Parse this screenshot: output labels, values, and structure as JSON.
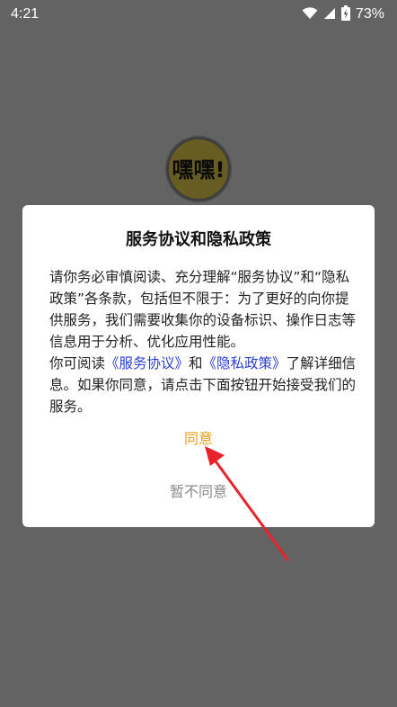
{
  "status_bar": {
    "time": "4:21",
    "battery_percent": "73%",
    "icons": [
      "wifi-icon",
      "signal-icon",
      "battery-charging-icon"
    ]
  },
  "logo": {
    "text": "嘿嘿!"
  },
  "dialog": {
    "title": "服务协议和隐私政策",
    "body_paragraph_1": "请你务必审慎阅读、充分理解“服务协议”和“隐私政策”各条款，包括但不限于：为了更好的向你提供服务，我们需要收集你的设备标识、操作日志等信息用于分析、优化应用性能。",
    "body_p2_prefix": "你可阅读",
    "terms_link": "《服务协议》",
    "body_p2_and": "和",
    "privacy_link": "《隐私政策》",
    "body_p2_suffix": "了解详细信息。如果你同意，请点击下面按钮开始接受我们的服务。",
    "agree_label": "同意",
    "disagree_label": "暂不同意"
  },
  "colors": {
    "scrim": "#636363",
    "link": "#2a3fd6",
    "agree": "#e6a11c",
    "disagree": "#8a8a8a",
    "annotation": "#e8232a"
  }
}
